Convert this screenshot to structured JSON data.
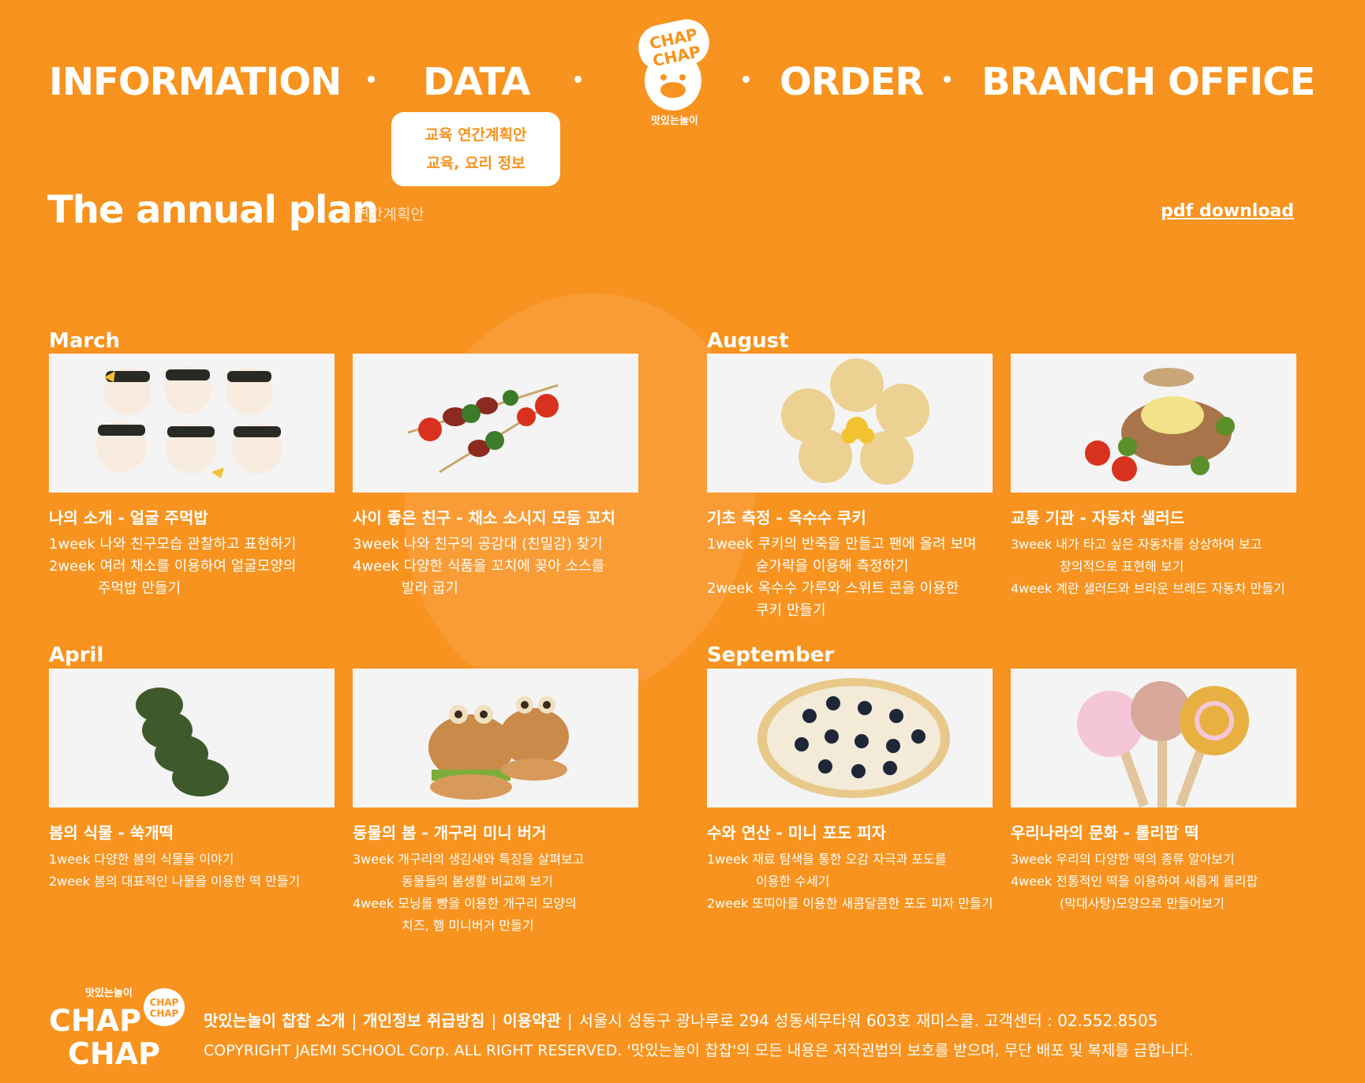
{
  "nav": {
    "information": "INFORMATION",
    "data": "DATA",
    "order": "ORDER",
    "branch_office": "BRANCH OFFICE",
    "logo_text_top": "CHAP",
    "logo_text_bottom": "CHAP",
    "logo_tagline": "맛있는놀이",
    "dropdown": [
      "교육 연간계획안",
      "교육, 요리 정보"
    ]
  },
  "page": {
    "title": "The annual plan",
    "subtitle": "| 연간계획안",
    "pdf_download": "pdf download"
  },
  "months": {
    "march": "March",
    "april": "April",
    "august": "August",
    "september": "September"
  },
  "cards": [
    {
      "title": "나의 소개 - 얼굴 주먹밥",
      "lines": [
        "1week 나와 친구모습 관찰하고 표현하기",
        "2week 여러 채소를 이용하여 얼굴모양의",
        "주먹밥 만들기"
      ],
      "photo": "rice-ball-faces-photo"
    },
    {
      "title": "사이 좋은 친구 - 채소 소시지 모둠 꼬치",
      "lines": [
        "3week 나와 친구의 공감대 (친밀감) 찾기",
        "4week 다양한 식품을 꼬치에 꽂아 소스를",
        "발라 굽기"
      ],
      "photo": "vegetable-sausage-skewer-photo"
    },
    {
      "title": "기초 측정 - 옥수수 쿠키",
      "lines": [
        "1week 쿠키의 반죽을 만들고 팬에 올려 보며",
        "숟가락을 이용해 측정하기",
        "2week 옥수수 가루와 스위트 콘을 이용한",
        "쿠키 만들기"
      ],
      "photo": "corn-cookie-photo"
    },
    {
      "title": "교통 기관 - 자동차 샐러드",
      "lines": [
        "3week 내가 타고 싶은 자동차를 상상하여 보고",
        "창의적으로 표현해 보기",
        "4week 계란 샐러드와 브라운 브레드 자동차 만들기"
      ],
      "photo": "car-salad-photo"
    },
    {
      "title": "봄의 식물 - 쑥개떡",
      "lines": [
        "1week 다양한 봄의 식물들 이야기",
        "2week 봄의 대표적인 나물을 이용한 떡 만들기"
      ],
      "photo": "mugwort-rice-cake-photo"
    },
    {
      "title": "동물의 봄 - 개구리 미니 버거",
      "lines": [
        "3week 개구리의 생김새와 특징을 살펴보고",
        "동물들의 봄생활 비교해 보기",
        "4week 모닝롤 빵을 이용한 개구리 모양의",
        "치즈, 햄 미니버거 만들기"
      ],
      "photo": "frog-mini-burger-photo"
    },
    {
      "title": "수와 연산 - 미니 포도 피자",
      "lines": [
        "1week 재료 탐색을 통한 오감 자극과 포도를",
        "이용한 수세기",
        "2week 또띠아를 이용한 새콤달콤한 포도 피자 만들기"
      ],
      "photo": "grape-pizza-photo"
    },
    {
      "title": "우리나라의 문화 - 롤리팝 떡",
      "lines": [
        "3week 우리의 다양한 떡의 종류 알아보기",
        "4week 전통적인 떡을 이용하여 새롭게 롤리팝",
        "(막대사탕)모양으로 만들어보기"
      ],
      "photo": "lollipop-rice-cake-photo"
    }
  ],
  "footer": {
    "logo_tagline": "맛있는놀이",
    "logo_top": "CHAP",
    "logo_bottom": "CHAP",
    "links": [
      "맛있는놀이 찹찹 소개",
      "개인정보 취급방침",
      "이용약관"
    ],
    "address": "서울시 성동구 광나루로  294 성동세무타워 603호 재미스쿨. 고객센터 : 02.552.8505",
    "copyright": "COPYRIGHT JAEMI SCHOOL Corp. ALL RIGHT RESERVED. '맛있는놀이 찹찹'의 모든 내용은 저작권법의 보호를 받으며, 무단 배포 및 복제를 금합니다."
  },
  "colors": {
    "background": "#f7931e",
    "text": "#ffffff",
    "photo_bg": "#f4f4f4"
  }
}
